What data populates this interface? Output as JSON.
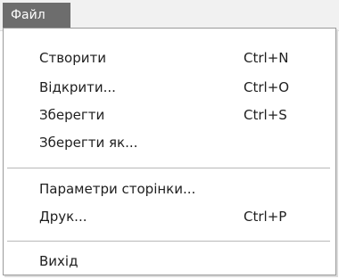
{
  "menu": {
    "title": "Файл",
    "items": [
      {
        "label": "Створити",
        "shortcut": "Ctrl+N"
      },
      {
        "label": "Відкрити...",
        "shortcut": "Ctrl+O"
      },
      {
        "label": "Зберегти",
        "shortcut": "Ctrl+S"
      },
      {
        "label": "Зберегти як...",
        "shortcut": ""
      },
      {
        "label": "Параметри сторінки...",
        "shortcut": ""
      },
      {
        "label": "Друк...",
        "shortcut": "Ctrl+P"
      },
      {
        "label": "Вихід",
        "shortcut": ""
      }
    ]
  },
  "colors": {
    "menu_title_bg": "#6d6d6d",
    "menu_title_text": "#ffffff",
    "menubar_bg": "#f1f1f1",
    "dropdown_bg": "#ffffff",
    "text": "#1e1e1e",
    "separator": "#b8b8b8"
  }
}
